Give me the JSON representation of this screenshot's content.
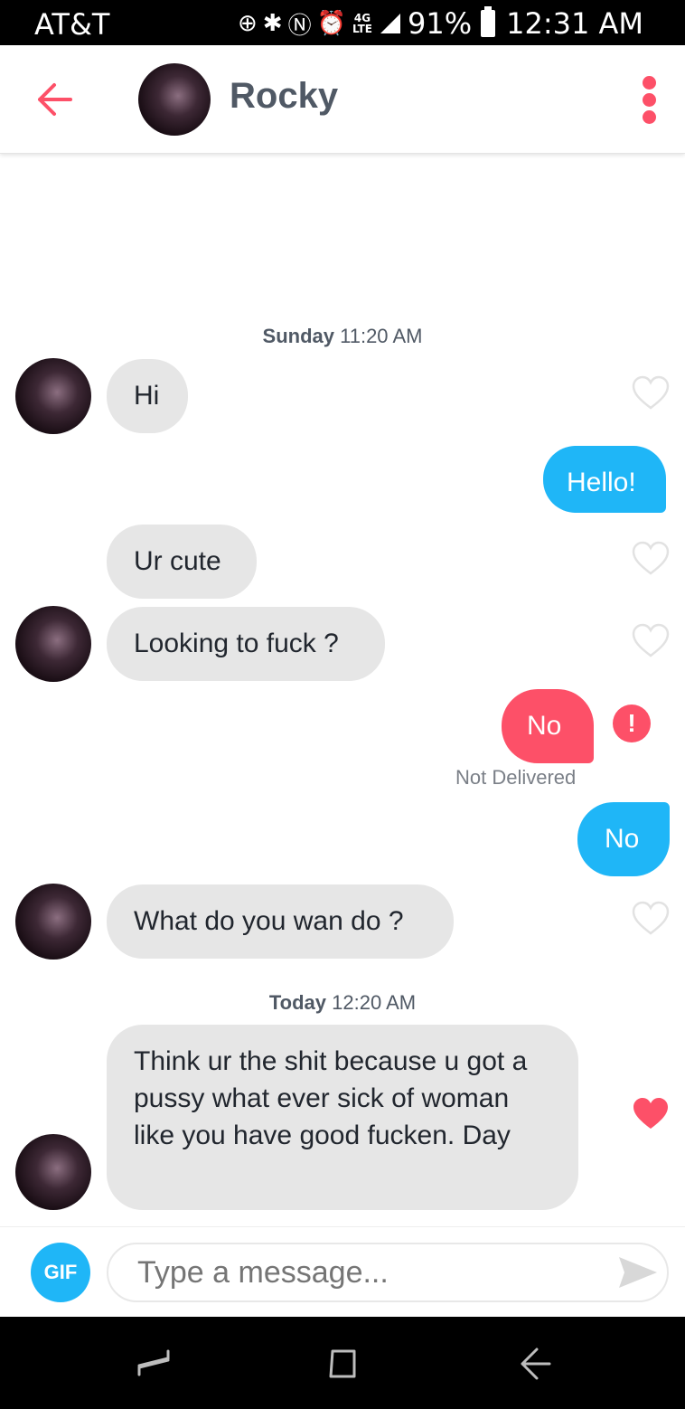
{
  "status_bar": {
    "carrier": "AT&T",
    "lte_label": "4G LTE",
    "battery": "91%",
    "time": "12:31 AM"
  },
  "header": {
    "contact_name": "Rocky",
    "back_icon": "arrow-left-icon",
    "menu_icon": "more-vertical-icon",
    "accent_color": "#fd5068"
  },
  "messages": {
    "ts1_day": "Sunday",
    "ts1_time": "11:20 AM",
    "m1": "Hi",
    "m2": "Hello!",
    "m3": "Ur cute",
    "m4": "Looking to fuck ?",
    "m5": "No",
    "m5_status": "Not Delivered",
    "m6": "No",
    "m7": "What do you wan do ?",
    "ts2_day": "Today",
    "ts2_time": "12:20 AM",
    "m8": "Think ur the shit because u got a pussy what ever sick of woman like you have good fucken. Day",
    "sent_color": "#1fb6f7",
    "received_color": "#e6e6e6",
    "error_color": "#fd5068"
  },
  "input": {
    "gif_label": "GIF",
    "placeholder": "Type a message..."
  }
}
